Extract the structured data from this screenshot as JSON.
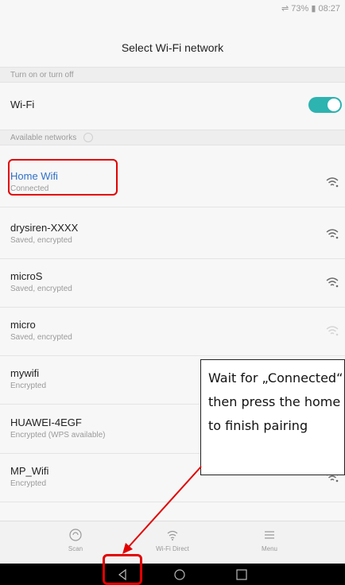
{
  "status_bar": {
    "text": "⇌ 73% ▮ 08:27"
  },
  "header": {
    "title": "Select Wi-Fi network"
  },
  "sections": {
    "turn_on_off": "Turn on or turn off",
    "available": "Available networks"
  },
  "wifi_toggle": {
    "label": "Wi-Fi",
    "state": "on"
  },
  "networks": [
    {
      "name": "Home Wifi",
      "status": "Connected",
      "signal": "strong",
      "connected": true
    },
    {
      "name": "drysiren-XXXX",
      "status": "Saved, encrypted",
      "signal": "strong"
    },
    {
      "name": "microS",
      "status": "Saved, encrypted",
      "signal": "strong"
    },
    {
      "name": "micro",
      "status": "Saved, encrypted",
      "signal": "weak"
    },
    {
      "name": "mywifi",
      "status": "Encrypted",
      "signal": "strong"
    },
    {
      "name": "HUAWEI-4EGF",
      "status": "Encrypted (WPS available)",
      "signal": "strong"
    },
    {
      "name": "MP_Wifi",
      "status": "Encrypted",
      "signal": "strong"
    }
  ],
  "bottom_tabs": {
    "scan": "Scan",
    "wifi_direct": "Wi-Fi Direct",
    "menu": "Menu"
  },
  "callout": {
    "text": "Wait for „Connected“ status then press the home button to finish pairing"
  },
  "colors": {
    "accent": "#2db3b0",
    "connected": "#2f70c9",
    "annotation": "#e20000"
  }
}
